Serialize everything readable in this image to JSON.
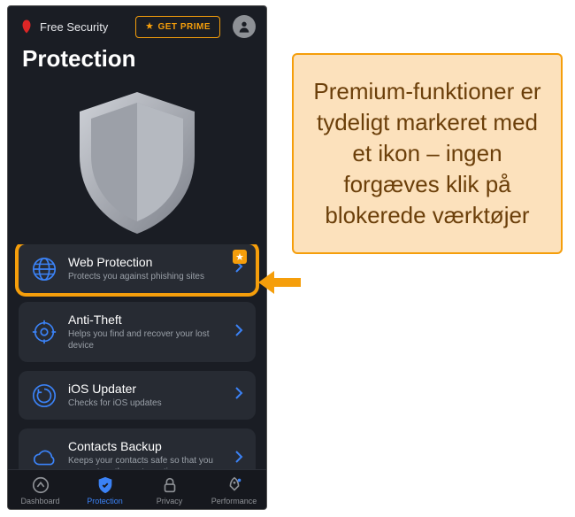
{
  "header": {
    "brand": "Free Security",
    "prime_label": "GET PRIME"
  },
  "title": "Protection",
  "items": [
    {
      "title": "Web Protection",
      "subtitle": "Protects you against phishing sites",
      "premium": true,
      "highlighted": true
    },
    {
      "title": "Anti-Theft",
      "subtitle": "Helps you find and recover your lost device"
    },
    {
      "title": "iOS Updater",
      "subtitle": "Checks for iOS updates"
    },
    {
      "title": "Contacts Backup",
      "subtitle": "Keeps your contacts safe so that you can restore them at any time"
    }
  ],
  "nav": {
    "dashboard": "Dashboard",
    "protection": "Protection",
    "privacy": "Privacy",
    "performance": "Performance"
  },
  "callout": "Premium-funktioner er tydeligt markeret med et ikon – ingen forgæves klik på blokerede værktøjer"
}
